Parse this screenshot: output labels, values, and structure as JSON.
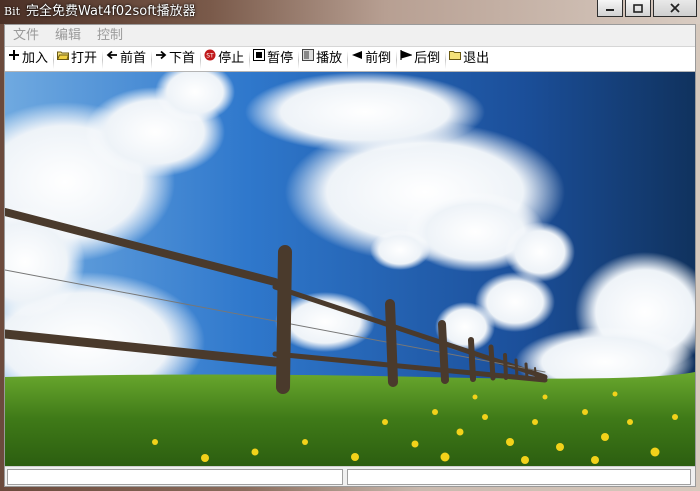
{
  "window": {
    "title": "完全免费Wat4f02soft播放器",
    "icon_text": "Bit",
    "controls": [
      "minimize",
      "maximize",
      "close"
    ]
  },
  "menu": [
    {
      "label": "文件"
    },
    {
      "label": "编辑"
    },
    {
      "label": "控制"
    }
  ],
  "toolbar": [
    {
      "label": "加入",
      "icon": "add-icon"
    },
    {
      "label": "打开",
      "icon": "open-folder-icon"
    },
    {
      "label": "前首",
      "icon": "arrow-left-icon"
    },
    {
      "label": "下首",
      "icon": "arrow-right-icon"
    },
    {
      "label": "停止",
      "icon": "stop-icon"
    },
    {
      "label": "暂停",
      "icon": "pause-icon"
    },
    {
      "label": "播放",
      "icon": "play-icon"
    },
    {
      "label": "前倒",
      "icon": "rewind-icon"
    },
    {
      "label": "后倒",
      "icon": "forward-icon"
    },
    {
      "label": "退出",
      "icon": "exit-folder-icon"
    }
  ],
  "video": {
    "content": "landscape-frame",
    "colors": {
      "sky": "#2f6fbf",
      "grass": "#4e8e1e",
      "flowers": "#f2d21a",
      "fence": "#4a3a2c"
    }
  },
  "statusbar": {
    "panes": [
      "",
      ""
    ]
  }
}
